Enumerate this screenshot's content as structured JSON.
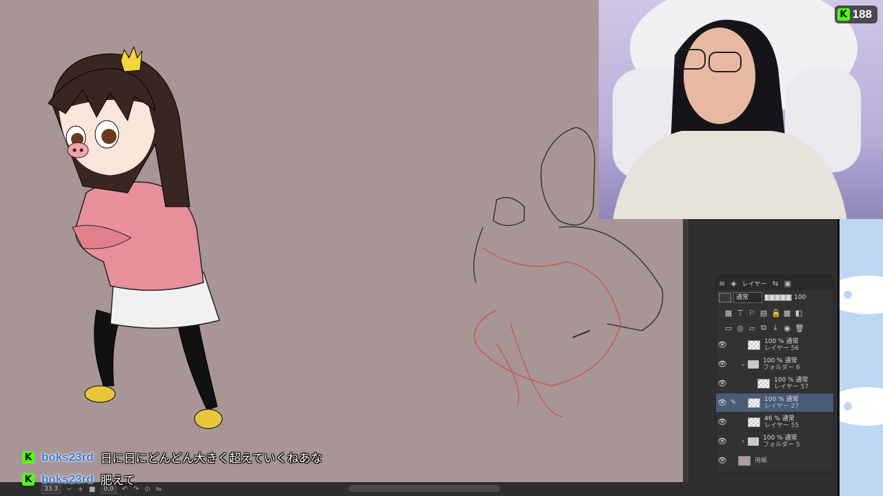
{
  "stream": {
    "viewer_count": "188",
    "platform_icon": "kick-logo"
  },
  "chat": [
    {
      "user": "boks23rd",
      "message": "日に日にどんどん大きく超えていくねあな"
    },
    {
      "user": "boks23rd",
      "message": "肥えて"
    }
  ],
  "layer_panel": {
    "tab_label": "レイヤー",
    "blend_mode": "通常",
    "opacity": "100",
    "layers": [
      {
        "mode": "100 % 通常",
        "name": "レイヤー 56",
        "type": "layer",
        "indent": 0,
        "selected": false
      },
      {
        "mode": "100 % 通常",
        "name": "フォルダー 6",
        "type": "folder-open",
        "indent": 0,
        "selected": false
      },
      {
        "mode": "100 % 通常",
        "name": "レイヤー 57",
        "type": "layer",
        "indent": 1,
        "selected": false
      },
      {
        "mode": "100 % 通常",
        "name": "レイヤー 27",
        "type": "layer",
        "indent": 1,
        "selected": true
      },
      {
        "mode": "46 % 通常",
        "name": "レイヤー 55",
        "type": "layer",
        "indent": 1,
        "selected": false
      },
      {
        "mode": "100 % 通常",
        "name": "フォルダー 5",
        "type": "folder-closed",
        "indent": 0,
        "selected": false
      },
      {
        "mode": "",
        "name": "用紙",
        "type": "paper",
        "indent": 0,
        "selected": false
      }
    ]
  },
  "statusbar": {
    "zoom": "33.3",
    "angle": "0.0"
  },
  "colors": {
    "canvas_bg": "#a89596",
    "selected_layer": "#4a5b78",
    "kick_green": "#53fc18",
    "chat_username": "#3b7bd4"
  }
}
